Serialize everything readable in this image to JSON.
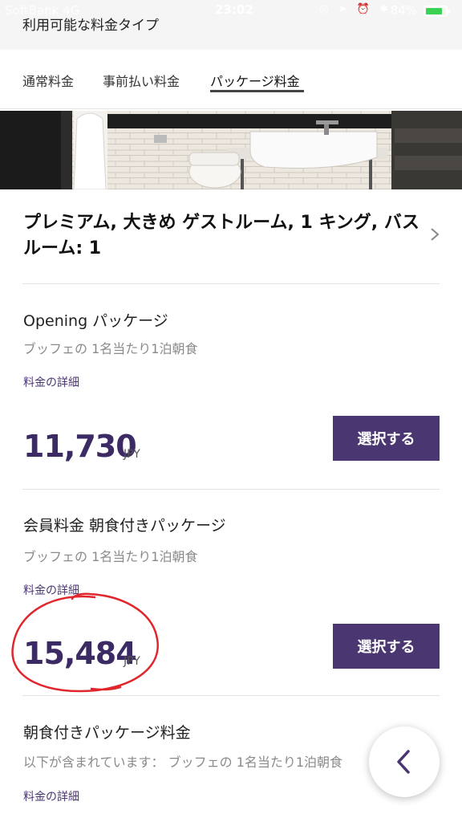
{
  "status_bar": {
    "carrier": "SoftBank 4G",
    "time": "23:02",
    "battery_percent": "84%",
    "battery_level": 0.84,
    "battery_color": "#3ad154"
  },
  "header": {
    "title": "利用可能な料金タイプ"
  },
  "tabs": [
    {
      "label": "通常料金",
      "active": false
    },
    {
      "label": "事前払い料金",
      "active": false
    },
    {
      "label": "パッケージ料金",
      "active": true
    }
  ],
  "room": {
    "title": "プレミアム, 大きめ ゲストルーム, 1 キング, バスルーム: 1",
    "chevron_icon": "chevron-right-icon"
  },
  "packages": [
    {
      "name": "Opening パッケージ",
      "desc": "ブッフェの 1名当たり1泊朝食",
      "link": "料金の詳細",
      "price": "11,730",
      "currency": "JPY",
      "button": "選択する"
    },
    {
      "name": "会員料金 朝食付きパッケージ",
      "desc": "ブッフェの 1名当たり1泊朝食",
      "link": "料金の詳細",
      "price": "15,484",
      "currency": "JPY",
      "button": "選択する"
    },
    {
      "name": "朝食付きパッケージ料金",
      "desc": "以下が含まれています： ブッフェの 1名当たり1泊朝食",
      "link": "料金の詳細"
    }
  ],
  "fab": {
    "icon": "chevron-left-icon"
  },
  "colors": {
    "brand_purple": "#4a3670",
    "price_purple": "#3b2a63",
    "annotation_red": "#e0262c"
  }
}
